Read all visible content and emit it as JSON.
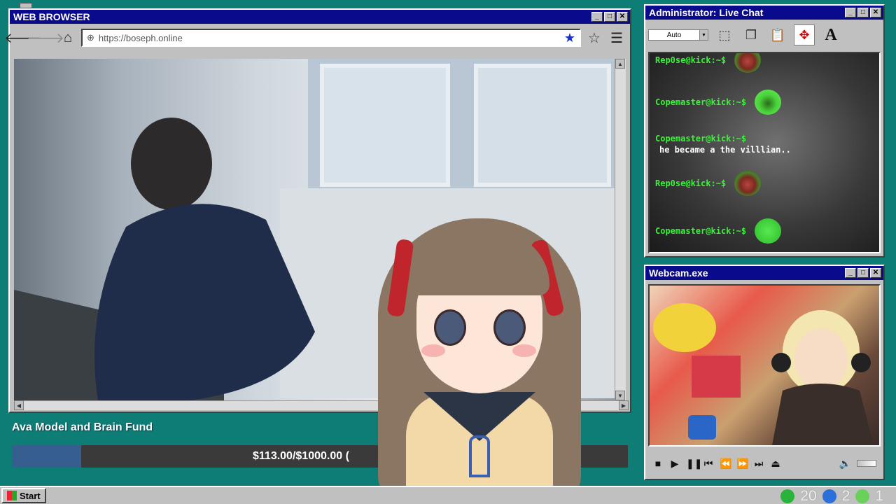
{
  "browser": {
    "title": "WEB BROWSER",
    "url": "https://boseph.online",
    "icons": [
      "back-arrow-icon",
      "forward-arrow-icon",
      "home-icon",
      "globe-icon",
      "star-filled-icon",
      "star-outline-icon",
      "menu-icon"
    ]
  },
  "chat": {
    "title": "Administrator: Live Chat",
    "font_size_value": "Auto",
    "messages": [
      {
        "user": "Rep0se@kick:~$",
        "text": "",
        "emote": "pepe-scream"
      },
      {
        "user": "Copemaster@kick:~$",
        "text": "",
        "emote": "laugh"
      },
      {
        "user": "Copemaster@kick:~$",
        "text": "he became a the villlian..",
        "emote": ""
      },
      {
        "user": "Rep0se@kick:~$",
        "text": "",
        "emote": "pepe-scream"
      },
      {
        "user": "Copemaster@kick:~$",
        "text": "",
        "emote": "sick"
      }
    ]
  },
  "webcam": {
    "title": "Webcam.exe"
  },
  "fund": {
    "title": "Ava Model and Brain Fund",
    "progress_text": "$113.00/$1000.00 (",
    "progress_fraction": 0.113
  },
  "taskbar": {
    "start_label": "Start",
    "tray": [
      {
        "icon": "kick-icon",
        "value": "20"
      },
      {
        "icon": "moon-icon",
        "value": "2"
      },
      {
        "icon": "play-icon",
        "value": "1"
      }
    ]
  },
  "colors": {
    "desktop": "#0e7d75",
    "titlebar": "#0a0a8c",
    "chat_username": "#3cf03c",
    "fund_fill": "#365f8f"
  }
}
